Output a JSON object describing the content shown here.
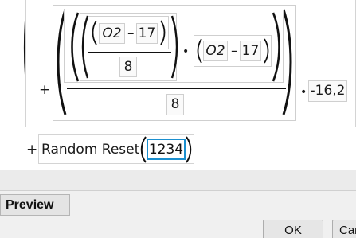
{
  "formula": {
    "plus_sign": "+",
    "dot": "•",
    "var_a": "O2",
    "minus_a": "–",
    "const_a": "17",
    "denominator_inner": "8",
    "var_b": "O2",
    "minus_b": "–",
    "const_b": "17",
    "denominator_outer": "8",
    "coefficient": "-16,2"
  },
  "random_reset": {
    "plus_sign": "+",
    "label": "Random Reset",
    "seed_value": "1234"
  },
  "footer": {
    "preview_label": "Preview",
    "ok_label": "OK",
    "cancel_label": "Car"
  },
  "colors": {
    "focus_outline": "#1a8fcf",
    "editor_background": "#ffffff",
    "window_background": "#f0f0f0"
  }
}
